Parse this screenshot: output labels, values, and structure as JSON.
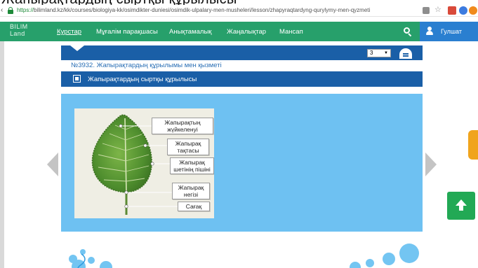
{
  "browser": {
    "url_protocol": "https://",
    "url_rest": "bilimland.kz/kk/courses/biologiya-kk/osimdikter-duniesi/osimdik-ulpalary-men-musheleri/lesson/zhapyraqtardyng-qurylymy-men-qyzmeti"
  },
  "nav": {
    "logo_line1": "BILIM",
    "logo_line2": "Land",
    "items": [
      "Курстар",
      "Мұғалім парақшасы",
      "Анықтамалық",
      "Жаңалықтар",
      "Мансап"
    ],
    "user_name": "Гулшат"
  },
  "lesson": {
    "grade": "3",
    "title": "№3932. Жапырақтардың құрылымы мен қызметі",
    "section": "Жапырақтардың сыртқы құрылысы"
  },
  "figure": {
    "callouts": [
      "Жапырақтың\nжүйкеленуі",
      "Жапырақ\nтақтасы",
      "Жапырақ\nшетінің пішіні",
      "Жапырақ\nнегізі",
      "Сағақ"
    ]
  },
  "colors": {
    "nav_green": "#27a06b",
    "user_blue": "#2a7fd0",
    "header_blue": "#1a5fa7",
    "panel_blue": "#6ec1f2",
    "scroll_up_green": "#22a955",
    "tab_orange": "#f0a41d"
  },
  "icons": [
    "lock-icon",
    "search-icon",
    "user-icon",
    "home-icon",
    "arrow-left-icon",
    "arrow-right-icon",
    "arrow-up-icon"
  ]
}
